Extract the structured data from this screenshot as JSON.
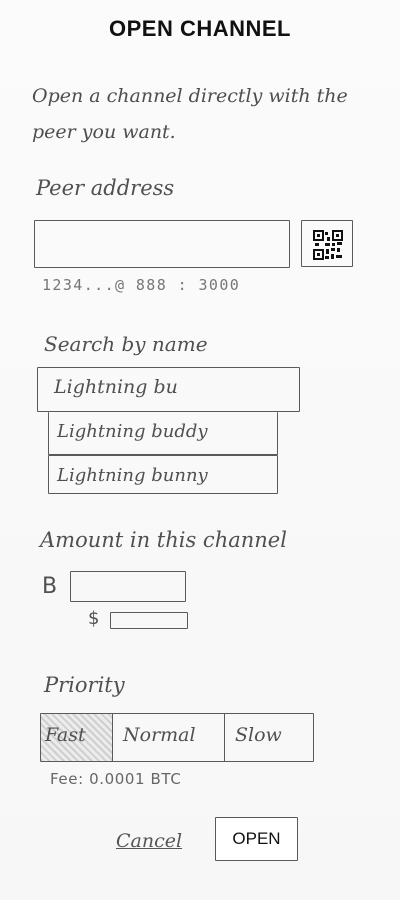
{
  "screen": {
    "title": "OPEN CHANNEL",
    "intro": "Open a channel directly with the peer you want."
  },
  "peer": {
    "label": "Peer address",
    "value": "",
    "hint": "1234...@ 888 : 3000",
    "qr_icon": "qr-code-icon"
  },
  "search": {
    "label": "Search by name",
    "value": "Lightning bu",
    "suggestions": [
      "Lightning buddy",
      "Lightning bunny"
    ]
  },
  "amount": {
    "label": "Amount in this channel",
    "btc_symbol": "B",
    "btc_value": "",
    "usd_symbol": "$",
    "usd_value": ""
  },
  "priority": {
    "label": "Priority",
    "options": [
      "Fast",
      "Normal",
      "Slow"
    ],
    "selected": "Fast"
  },
  "fee": "Fee: 0.0001 BTC",
  "actions": {
    "cancel": "Cancel",
    "open": "OPEN"
  }
}
